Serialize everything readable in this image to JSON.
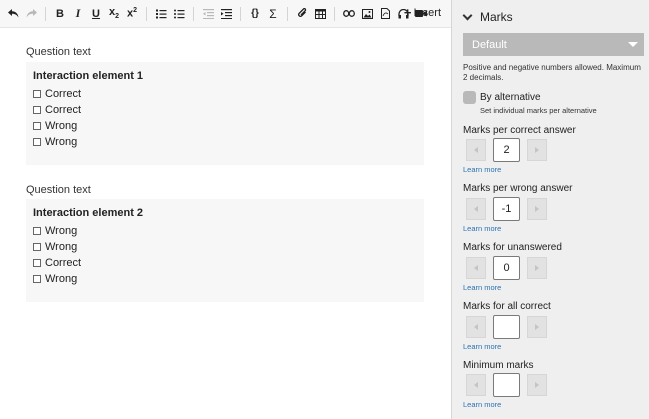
{
  "toolbar": {
    "insert_label": "Insert"
  },
  "editor": {
    "questions": [
      {
        "label": "Question text",
        "title": "Interaction element 1",
        "options": [
          "Correct",
          "Correct",
          "Wrong",
          "Wrong"
        ]
      },
      {
        "label": "Question text",
        "title": "Interaction element 2",
        "options": [
          "Wrong",
          "Wrong",
          "Correct",
          "Wrong"
        ]
      }
    ]
  },
  "panel": {
    "title": "Marks",
    "select_value": "Default",
    "hint": "Positive and negative numbers allowed. Maximum 2 decimals.",
    "by_alternative_label": "By alternative",
    "by_alternative_sub": "Set individual marks per alternative",
    "learn_more": "Learn more",
    "fields": [
      {
        "label": "Marks per correct answer",
        "value": "2"
      },
      {
        "label": "Marks per wrong answer",
        "value": "-1"
      },
      {
        "label": "Marks for unanswered",
        "value": "0"
      },
      {
        "label": "Marks for all correct",
        "value": ""
      },
      {
        "label": "Minimum marks",
        "value": ""
      }
    ]
  }
}
